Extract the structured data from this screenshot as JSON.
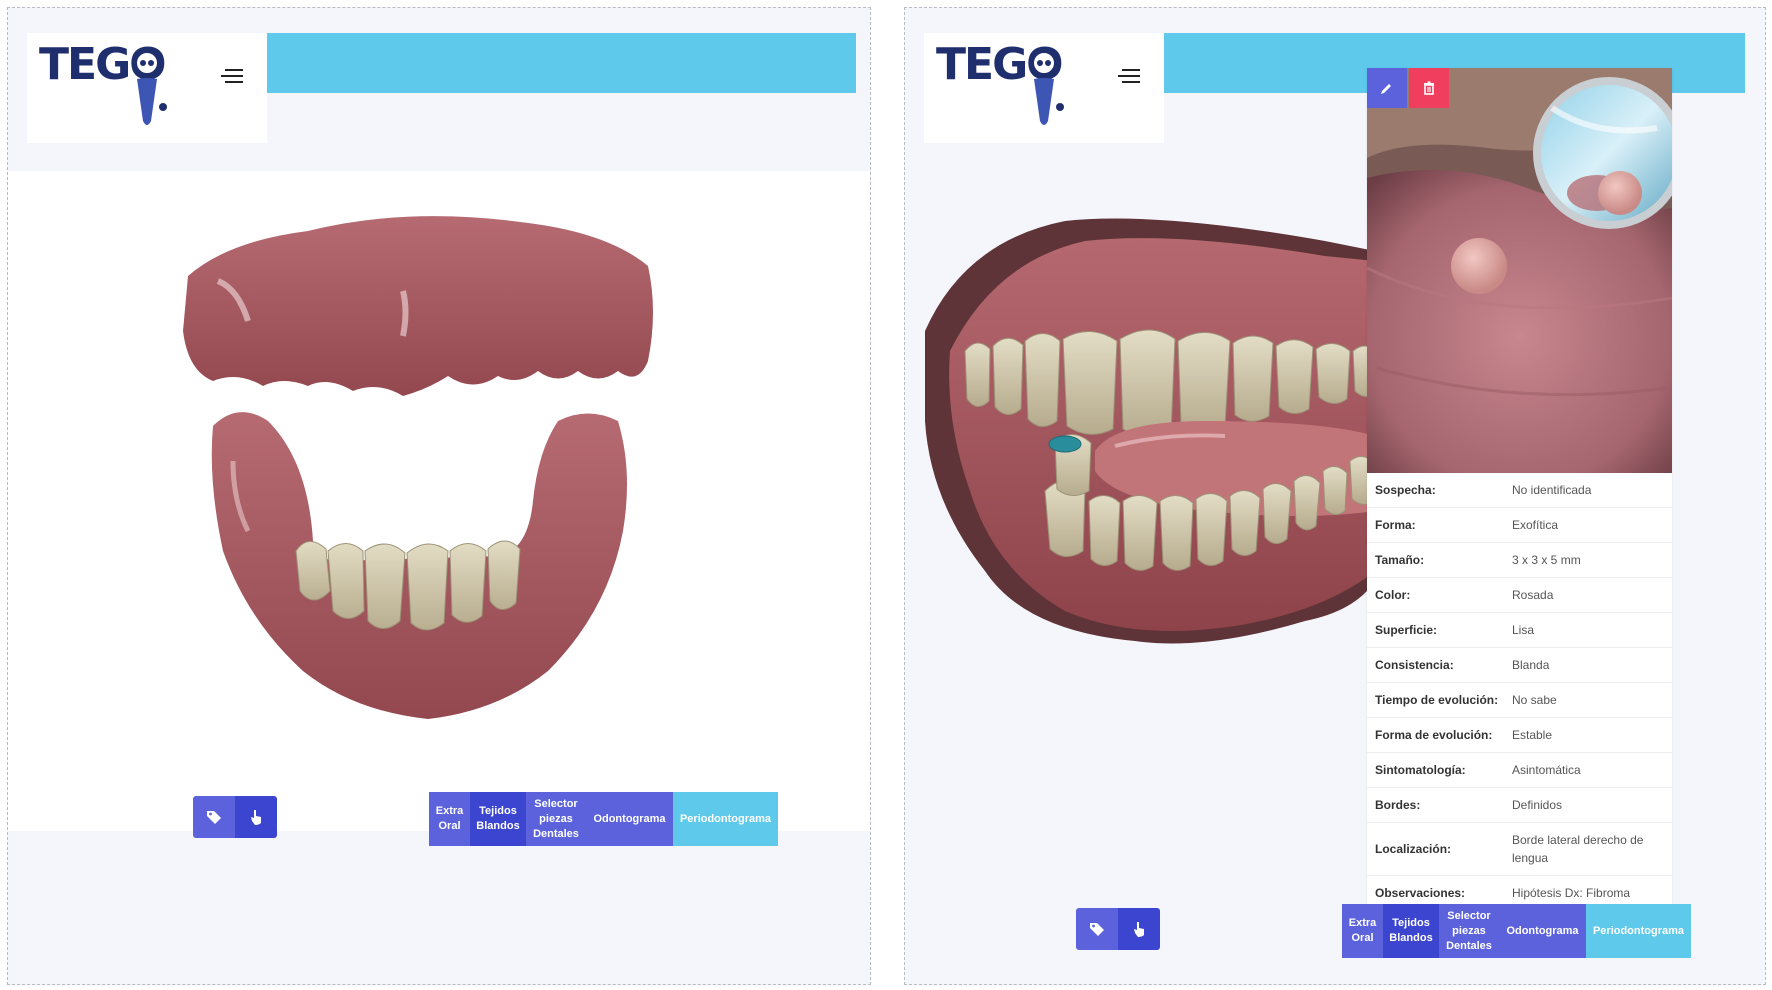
{
  "brand": {
    "logo_text": "TEGO",
    "accent": "#5ec9ea",
    "primary": "#3b45cf",
    "primary_light": "#5b62db",
    "danger": "#f03e5f"
  },
  "icons": {
    "menu": "hamburger-menu-icon",
    "tag": "tag-icon",
    "hand": "hand-pointer-icon",
    "edit": "pencil-icon",
    "delete": "trash-icon"
  },
  "tabs": [
    {
      "label": "Extra Oral"
    },
    {
      "label": "Tejidos Blandos"
    },
    {
      "label": "Selector piezas Dentales"
    },
    {
      "label": "Odontograma"
    },
    {
      "label": "Periodontograma"
    }
  ],
  "lesion": {
    "rows": [
      {
        "label": "Sospecha:",
        "value": "No identificada"
      },
      {
        "label": "Forma:",
        "value": "Exofítica"
      },
      {
        "label": "Tamaño:",
        "value": "3 x 3 x 5 mm"
      },
      {
        "label": "Color:",
        "value": "Rosada"
      },
      {
        "label": "Superficie:",
        "value": "Lisa"
      },
      {
        "label": "Consistencia:",
        "value": "Blanda"
      },
      {
        "label": "Tiempo de evolución:",
        "value": "No sabe"
      },
      {
        "label": "Forma de evolución:",
        "value": "Estable"
      },
      {
        "label": "Sintomatología:",
        "value": "Asintomática"
      },
      {
        "label": "Bordes:",
        "value": "Definidos"
      },
      {
        "label": "Localización:",
        "value": "Borde lateral derecho de lengua"
      },
      {
        "label": "Observaciones:",
        "value": "Hipótesis Dx: Fibroma"
      }
    ]
  }
}
